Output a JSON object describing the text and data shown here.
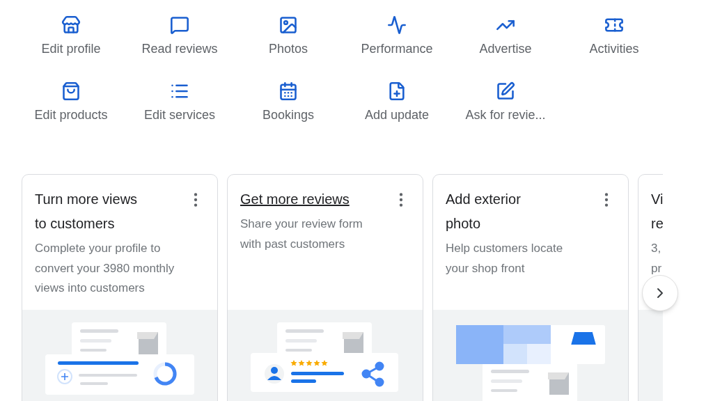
{
  "actions": [
    {
      "label": "Edit profile"
    },
    {
      "label": "Read reviews"
    },
    {
      "label": "Photos"
    },
    {
      "label": "Performance"
    },
    {
      "label": "Advertise"
    },
    {
      "label": "Activities"
    },
    {
      "label": "Edit products"
    },
    {
      "label": "Edit services"
    },
    {
      "label": "Bookings"
    },
    {
      "label": "Add update"
    },
    {
      "label": "Ask for revie..."
    }
  ],
  "cards": [
    {
      "title_lines": [
        "Turn more views",
        "to customers"
      ],
      "link": false,
      "description_lines": [
        "Complete your profile to",
        "convert your 3980 monthly",
        "views into customers"
      ],
      "kind": "profile",
      "menu": true
    },
    {
      "title_lines": [
        "Get more reviews"
      ],
      "link": true,
      "description_lines": [
        "Share your review form",
        "with past customers"
      ],
      "kind": "reviews",
      "menu": true
    },
    {
      "title_lines": [
        "Add exterior",
        "photo"
      ],
      "link": false,
      "description_lines": [
        "Help customers locate",
        "your shop front"
      ],
      "kind": "photo",
      "menu": true
    },
    {
      "title_lines": [
        "Vi",
        "re"
      ],
      "link": false,
      "description_lines": [
        "3,",
        "pr"
      ],
      "kind": "plain",
      "menu": false
    }
  ]
}
